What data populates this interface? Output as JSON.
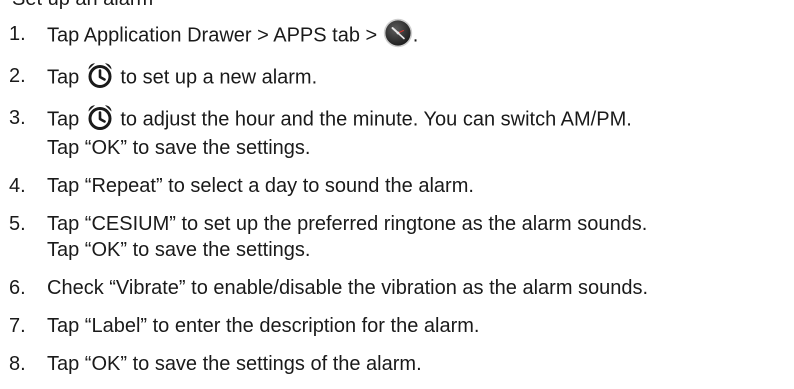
{
  "heading_fragment": "Set up an alarm",
  "steps": [
    {
      "number": "1.",
      "lines": [
        {
          "before": "Tap Application Drawer > APPS tab > ",
          "icon": "clock-app-icon",
          "after": "."
        }
      ]
    },
    {
      "number": "2.",
      "lines": [
        {
          "before": "Tap ",
          "icon": "alarm-clock-icon",
          "after": " to set up a new alarm."
        }
      ]
    },
    {
      "number": "3.",
      "lines": [
        {
          "before": "Tap ",
          "icon": "alarm-clock-icon",
          "after": " to adjust the hour and the minute. You can switch AM/PM."
        },
        {
          "text": "Tap “OK” to save the settings."
        }
      ]
    },
    {
      "number": "4.",
      "lines": [
        {
          "text": "Tap “Repeat” to select a day to sound the alarm."
        }
      ]
    },
    {
      "number": "5.",
      "lines": [
        {
          "text": "Tap “CESIUM” to set up the preferred ringtone as the alarm sounds."
        },
        {
          "text": "Tap “OK” to save the settings."
        }
      ]
    },
    {
      "number": "6.",
      "lines": [
        {
          "text": "Check “Vibrate” to enable/disable the vibration as the alarm sounds."
        }
      ]
    },
    {
      "number": "7.",
      "lines": [
        {
          "text": "Tap “Label” to enter the description for the alarm."
        }
      ]
    },
    {
      "number": "8.",
      "lines": [
        {
          "text": "Tap “OK” to save the settings of the alarm."
        }
      ]
    }
  ]
}
